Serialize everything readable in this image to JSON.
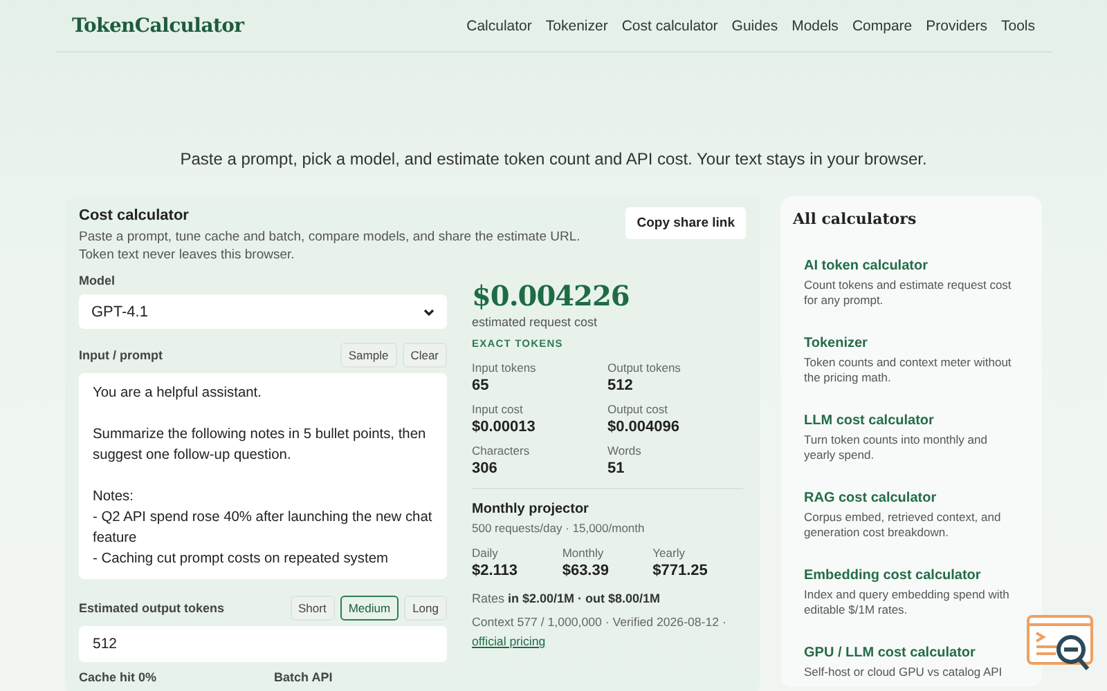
{
  "header": {
    "logo": "TokenCalculator",
    "nav": [
      "Calculator",
      "Tokenizer",
      "Cost calculator",
      "Guides",
      "Models",
      "Compare",
      "Providers",
      "Tools"
    ]
  },
  "tagline": "Paste a prompt, pick a model, and estimate token count and API cost. Your text stays in your browser.",
  "calculator": {
    "title": "Cost calculator",
    "description": "Paste a prompt, tune cache and batch, compare models, and share the estimate URL.",
    "note": "Token text never leaves this browser.",
    "share_button": "Copy share link",
    "model": {
      "label": "Model",
      "value": "GPT-4.1"
    },
    "prompt": {
      "label": "Input / prompt",
      "buttons": [
        "Sample",
        "Clear"
      ],
      "paragraphs": [
        [
          "You are a helpful assistant."
        ],
        [
          "Summarize the following notes in 5 bullet points, then suggest one follow-up question."
        ],
        [
          "Notes:",
          "- Q2 API spend rose 40% after launching the new chat feature",
          "- Caching cut prompt costs on repeated system"
        ]
      ]
    },
    "output": {
      "label": "Estimated output tokens",
      "presets": [
        {
          "label": "Short",
          "selected": false
        },
        {
          "label": "Medium",
          "selected": true
        },
        {
          "label": "Long",
          "selected": false
        }
      ],
      "value": "512"
    },
    "bottom_labels": [
      "Cache hit 0%",
      "Batch API"
    ],
    "result": {
      "total": "$0.004226",
      "caption": "estimated request cost",
      "badge": "EXACT TOKENS",
      "stats": [
        {
          "label": "Input tokens",
          "value": "65"
        },
        {
          "label": "Output tokens",
          "value": "512"
        },
        {
          "label": "Input cost",
          "value": "$0.00013"
        },
        {
          "label": "Output cost",
          "value": "$0.004096"
        },
        {
          "label": "Characters",
          "value": "306"
        },
        {
          "label": "Words",
          "value": "51"
        }
      ],
      "projector": {
        "title": "Monthly projector",
        "subtitle": "500 requests/day · 15,000/month",
        "items": [
          {
            "label": "Daily",
            "value": "$2.113"
          },
          {
            "label": "Monthly",
            "value": "$63.39"
          },
          {
            "label": "Yearly",
            "value": "$771.25"
          }
        ]
      },
      "rates": "Rates **in $2.00/1M · out $8.00/1M**",
      "context": "Context 577 / 1,000,000 · Verified 2026-08-12 ·",
      "pricing_link": "official pricing"
    }
  },
  "sidebar": {
    "title": "All calculators",
    "items": [
      {
        "title": "AI token calculator",
        "description": "Count tokens and estimate request cost for any prompt."
      },
      {
        "title": "Tokenizer",
        "description": "Token counts and context meter without the pricing math."
      },
      {
        "title": "LLM cost calculator",
        "description": "Turn token counts into monthly and yearly spend."
      },
      {
        "title": "RAG cost calculator",
        "description": "Corpus embed, retrieved context, and generation cost breakdown."
      },
      {
        "title": "Embedding cost calculator",
        "description": "Index and query embedding spend with editable $/1M rates."
      },
      {
        "title": "GPU / LLM cost calculator",
        "description": "Self-host or cloud GPU vs catalog API"
      }
    ]
  }
}
